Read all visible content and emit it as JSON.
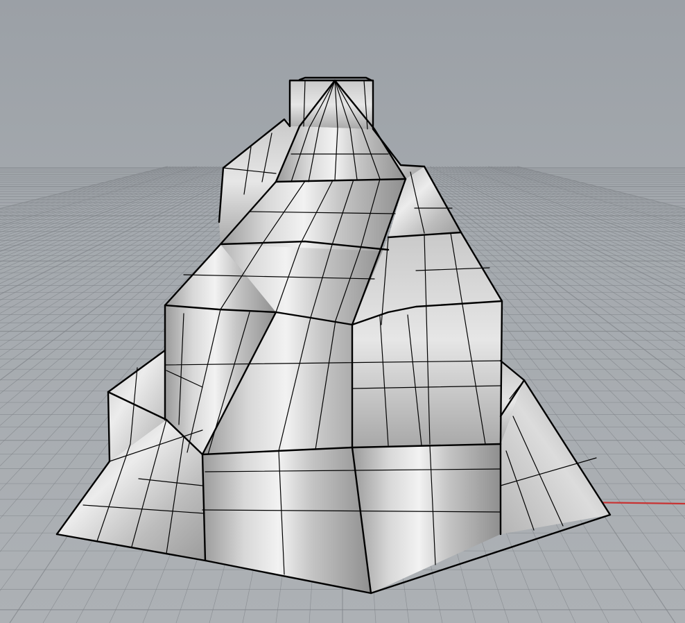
{
  "viewport": {
    "background_color": "#a6abb0",
    "grid_color": "#7f8388",
    "x_axis_color": "#c83232",
    "object": {
      "type": "subdivided-surface-mesh",
      "shading": "metallic-gray"
    }
  }
}
